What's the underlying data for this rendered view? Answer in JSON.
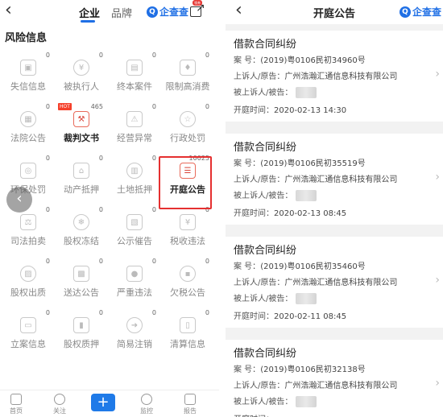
{
  "left": {
    "tabs": [
      "企业",
      "品牌"
    ],
    "brand": "企查查",
    "share_badge": "领券",
    "section_title": "风险信息",
    "grid": [
      {
        "label": "失信信息",
        "count": "0",
        "icon": "shield-icon"
      },
      {
        "label": "被执行人",
        "count": "0",
        "icon": "money-icon"
      },
      {
        "label": "终本案件",
        "count": "0",
        "icon": "document-icon"
      },
      {
        "label": "限制高消费",
        "count": "0",
        "icon": "badge-icon"
      },
      {
        "label": "法院公告",
        "count": "0",
        "icon": "court-notice-icon"
      },
      {
        "label": "裁判文书",
        "count": "465",
        "icon": "gavel-icon",
        "hot": "HOT"
      },
      {
        "label": "经营异常",
        "count": "0",
        "icon": "warning-icon"
      },
      {
        "label": "行政处罚",
        "count": "0",
        "icon": "stamp-icon"
      },
      {
        "label": "环保处罚",
        "count": "0",
        "icon": "leaf-icon"
      },
      {
        "label": "动产抵押",
        "count": "0",
        "icon": "house-icon"
      },
      {
        "label": "土地抵押",
        "count": "0",
        "icon": "land-icon"
      },
      {
        "label": "开庭公告",
        "count": "10025",
        "icon": "notice-icon"
      },
      {
        "label": "司法拍卖",
        "count": "0",
        "icon": "auction-icon"
      },
      {
        "label": "股权冻结",
        "count": "0",
        "icon": "freeze-icon"
      },
      {
        "label": "公示催告",
        "count": "0",
        "icon": "announce-icon"
      },
      {
        "label": "税收违法",
        "count": "0",
        "icon": "tax-icon"
      },
      {
        "label": "股权出质",
        "count": "0",
        "icon": "pledge-icon"
      },
      {
        "label": "送达公告",
        "count": "0",
        "icon": "delivery-icon"
      },
      {
        "label": "严重违法",
        "count": "0",
        "icon": "alert-icon"
      },
      {
        "label": "欠税公告",
        "count": "0",
        "icon": "tax-due-icon"
      },
      {
        "label": "立案信息",
        "count": "0",
        "icon": "filing-icon"
      },
      {
        "label": "股权质押",
        "count": "0",
        "icon": "equity-icon"
      },
      {
        "label": "简易注销",
        "count": "0",
        "icon": "cancel-icon"
      },
      {
        "label": "清算信息",
        "count": "0",
        "icon": "clear-icon"
      }
    ],
    "nav": [
      {
        "label": "首页",
        "icon": "home-icon"
      },
      {
        "label": "关注",
        "icon": "heart-icon"
      },
      {
        "label": "监控",
        "icon": "monitor-icon"
      },
      {
        "label": "报告",
        "icon": "report-icon"
      }
    ]
  },
  "right": {
    "title": "开庭公告",
    "brand": "企查查",
    "cards": [
      {
        "title": "借款合同纠纷",
        "case_label": "案  号：",
        "case_no": "(2019)粤0106民初34960号",
        "appellant_label": "上诉人/原告：",
        "appellant": "广州浩瀚汇通信息科技有限公司",
        "appellee_label": "被上诉人/被告：",
        "time_label": "开庭时间：",
        "time": "2020-02-13 14:30"
      },
      {
        "title": "借款合同纠纷",
        "case_label": "案  号：",
        "case_no": "(2019)粤0106民初35519号",
        "appellant_label": "上诉人/原告：",
        "appellant": "广州浩瀚汇通信息科技有限公司",
        "appellee_label": "被上诉人/被告：",
        "time_label": "开庭时间：",
        "time": "2020-02-13 08:45"
      },
      {
        "title": "借款合同纠纷",
        "case_label": "案  号：",
        "case_no": "(2019)粤0106民初35460号",
        "appellant_label": "上诉人/原告：",
        "appellant": "广州浩瀚汇通信息科技有限公司",
        "appellee_label": "被上诉人/被告：",
        "time_label": "开庭时间：",
        "time": "2020-02-11 08:45"
      },
      {
        "title": "借款合同纠纷",
        "case_label": "案  号：",
        "case_no": "(2019)粤0106民初32138号",
        "appellant_label": "上诉人/原告：",
        "appellant": "广州浩瀚汇通信息科技有限公司",
        "appellee_label": "被上诉人/被告：",
        "time_label": "开庭时间：",
        "time": ""
      }
    ]
  },
  "colors": {
    "accent": "#1f6fe5",
    "highlight": "#e53030",
    "hot": "#f5402b"
  }
}
